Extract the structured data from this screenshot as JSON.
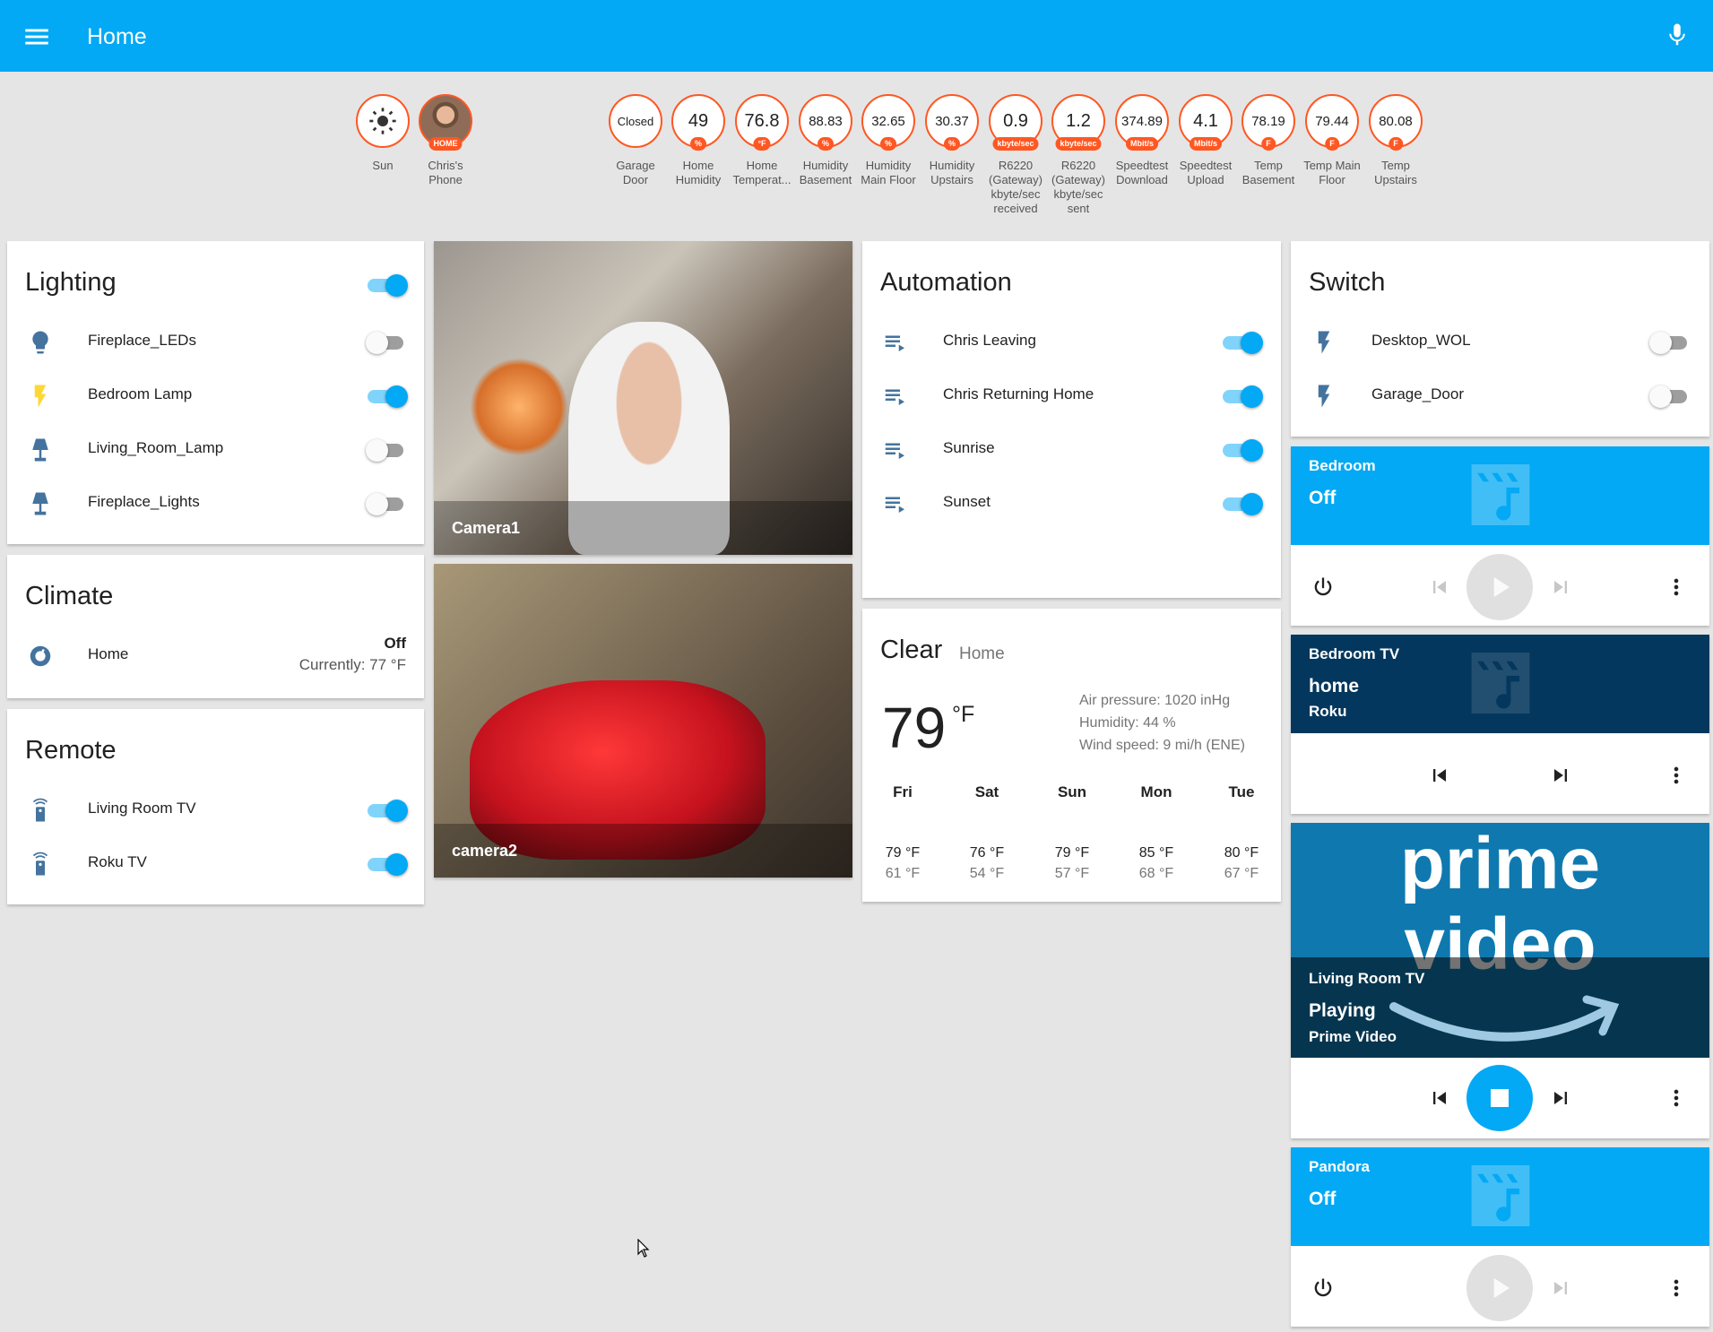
{
  "header": {
    "title": "Home",
    "menu_icon": "menu-icon",
    "mic_icon": "microphone-icon",
    "color": "#03a9f4"
  },
  "badges_left": [
    {
      "value": "",
      "unit": "",
      "label": "Sun"
    },
    {
      "value": "",
      "unit": "HOME",
      "label": "Chris's Phone"
    }
  ],
  "badges": [
    {
      "value": "Closed",
      "unit": "",
      "label": "Garage Door"
    },
    {
      "value": "49",
      "unit": "%",
      "label": "Home Humidity"
    },
    {
      "value": "76.8",
      "unit": "°F",
      "label": "Home Temperat..."
    },
    {
      "value": "88.83",
      "unit": "%",
      "label": "Humidity Basement"
    },
    {
      "value": "32.65",
      "unit": "%",
      "label": "Humidity Main Floor"
    },
    {
      "value": "30.37",
      "unit": "%",
      "label": "Humidity Upstairs"
    },
    {
      "value": "0.9",
      "unit": "kbyte/sec",
      "label": "R6220 (Gateway) kbyte/sec received"
    },
    {
      "value": "1.2",
      "unit": "kbyte/sec",
      "label": "R6220 (Gateway) kbyte/sec sent"
    },
    {
      "value": "374.89",
      "unit": "Mbit/s",
      "label": "Speedtest Download"
    },
    {
      "value": "4.1",
      "unit": "Mbit/s",
      "label": "Speedtest Upload"
    },
    {
      "value": "78.19",
      "unit": "F",
      "label": "Temp Basement"
    },
    {
      "value": "79.44",
      "unit": "F",
      "label": "Temp Main Floor"
    },
    {
      "value": "80.08",
      "unit": "F",
      "label": "Temp Upstairs"
    }
  ],
  "lighting": {
    "title": "Lighting",
    "master_on": true,
    "items": [
      {
        "label": "Fireplace_LEDs",
        "on": false,
        "icon": "lightbulb-icon"
      },
      {
        "label": "Bedroom Lamp",
        "on": true,
        "icon": "flash-icon"
      },
      {
        "label": "Living_Room_Lamp",
        "on": false,
        "icon": "lamp-icon"
      },
      {
        "label": "Fireplace_Lights",
        "on": false,
        "icon": "lamp-icon"
      }
    ]
  },
  "climate": {
    "title": "Climate",
    "item": {
      "label": "Home",
      "state": "Off",
      "current": "Currently: 77 °F"
    }
  },
  "remote": {
    "title": "Remote",
    "items": [
      {
        "label": "Living Room TV",
        "on": true
      },
      {
        "label": "Roku TV",
        "on": true
      }
    ]
  },
  "cameras": [
    {
      "label": "Camera1"
    },
    {
      "label": "camera2"
    }
  ],
  "automation": {
    "title": "Automation",
    "items": [
      {
        "label": "Chris Leaving",
        "on": true
      },
      {
        "label": "Chris Returning Home",
        "on": true
      },
      {
        "label": "Sunrise",
        "on": true
      },
      {
        "label": "Sunset",
        "on": true
      }
    ]
  },
  "weather": {
    "condition": "Clear",
    "location": "Home",
    "temp": "79",
    "unit": "°F",
    "pressure": "Air pressure: 1020 inHg",
    "humidity": "Humidity: 44 %",
    "wind": "Wind speed: 9 mi/h (ENE)",
    "forecast": [
      {
        "day": "Fri",
        "hi": "79 °F",
        "lo": "61 °F"
      },
      {
        "day": "Sat",
        "hi": "76 °F",
        "lo": "54 °F"
      },
      {
        "day": "Sun",
        "hi": "79 °F",
        "lo": "57 °F"
      },
      {
        "day": "Mon",
        "hi": "85 °F",
        "lo": "68 °F"
      },
      {
        "day": "Tue",
        "hi": "80 °F",
        "lo": "67 °F"
      }
    ]
  },
  "switch": {
    "title": "Switch",
    "items": [
      {
        "label": "Desktop_WOL",
        "on": false
      },
      {
        "label": "Garage_Door",
        "on": false
      }
    ]
  },
  "media": [
    {
      "name": "Bedroom",
      "state": "Off",
      "sub": ""
    },
    {
      "name": "Bedroom TV",
      "state": "home",
      "sub": "Roku"
    },
    {
      "name": "Living Room TV",
      "state": "Playing",
      "sub": "Prime Video",
      "art_line1": "prime",
      "art_line2": "video"
    },
    {
      "name": "Pandora",
      "state": "Off",
      "sub": ""
    }
  ]
}
